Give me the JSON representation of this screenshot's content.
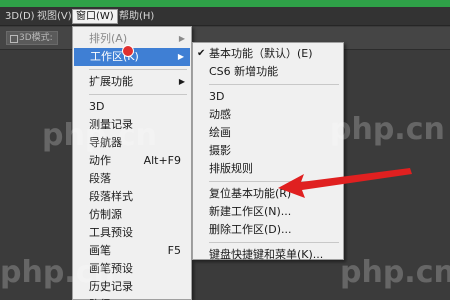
{
  "menubar": {
    "items": [
      {
        "label": "3D(D)"
      },
      {
        "label": "视图(V)"
      },
      {
        "label": "窗口(W)"
      },
      {
        "label": "帮助(H)"
      }
    ]
  },
  "optionbar": {
    "button_label": "3D模式:"
  },
  "window_menu": {
    "items_top": [
      {
        "label": "排列(A)"
      },
      {
        "label": "工作区(K)"
      },
      {
        "label": "扩展功能"
      }
    ],
    "panels": [
      {
        "label": "3D",
        "shortcut": ""
      },
      {
        "label": "测量记录",
        "shortcut": ""
      },
      {
        "label": "导航器",
        "shortcut": ""
      },
      {
        "label": "动作",
        "shortcut": "Alt+F9"
      },
      {
        "label": "段落",
        "shortcut": ""
      },
      {
        "label": "段落样式",
        "shortcut": ""
      },
      {
        "label": "仿制源",
        "shortcut": ""
      },
      {
        "label": "工具预设",
        "shortcut": ""
      },
      {
        "label": "画笔",
        "shortcut": "F5"
      },
      {
        "label": "画笔预设",
        "shortcut": ""
      },
      {
        "label": "历史记录",
        "shortcut": ""
      },
      {
        "label": "路径",
        "shortcut": ""
      }
    ]
  },
  "workspace_menu": {
    "group1": [
      {
        "label": "基本功能（默认）(E)",
        "checked": true
      },
      {
        "label": "CS6 新增功能",
        "checked": false
      }
    ],
    "group2": [
      {
        "label": "3D"
      },
      {
        "label": "动感"
      },
      {
        "label": "绘画"
      },
      {
        "label": "摄影"
      },
      {
        "label": "排版规则"
      }
    ],
    "group3": [
      {
        "label": "复位基本功能(R)"
      },
      {
        "label": "新建工作区(N)..."
      },
      {
        "label": "删除工作区(D)..."
      }
    ],
    "group4": [
      {
        "label": "键盘快捷键和菜单(K)..."
      }
    ]
  },
  "annotation": {
    "arrow_color": "#e02020"
  },
  "watermark": {
    "text": "php.cn"
  },
  "colors": {
    "accent_green": "#2fa148",
    "highlight_blue": "#3f7fd4"
  }
}
